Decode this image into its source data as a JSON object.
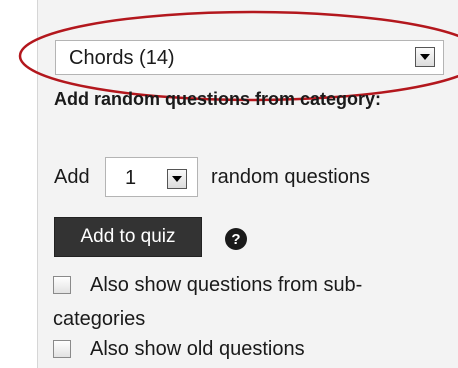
{
  "category_select": {
    "value": "Chords (14)"
  },
  "random": {
    "heading": "Add random questions from category:",
    "add_label": "Add",
    "count_value": "1",
    "suffix_label": "random questions",
    "add_button_label": "Add to quiz",
    "help_glyph": "?"
  },
  "options": {
    "subcategories_line1": "Also show questions from sub-",
    "subcategories_line2": "categories",
    "old_questions": "Also show old questions"
  },
  "colors": {
    "highlight": "#b3171d",
    "button_bg": "#333333",
    "panel_bg": "#f3f3f3"
  },
  "icons": {
    "dropdown": "chevron-down-icon",
    "help": "help-icon"
  }
}
